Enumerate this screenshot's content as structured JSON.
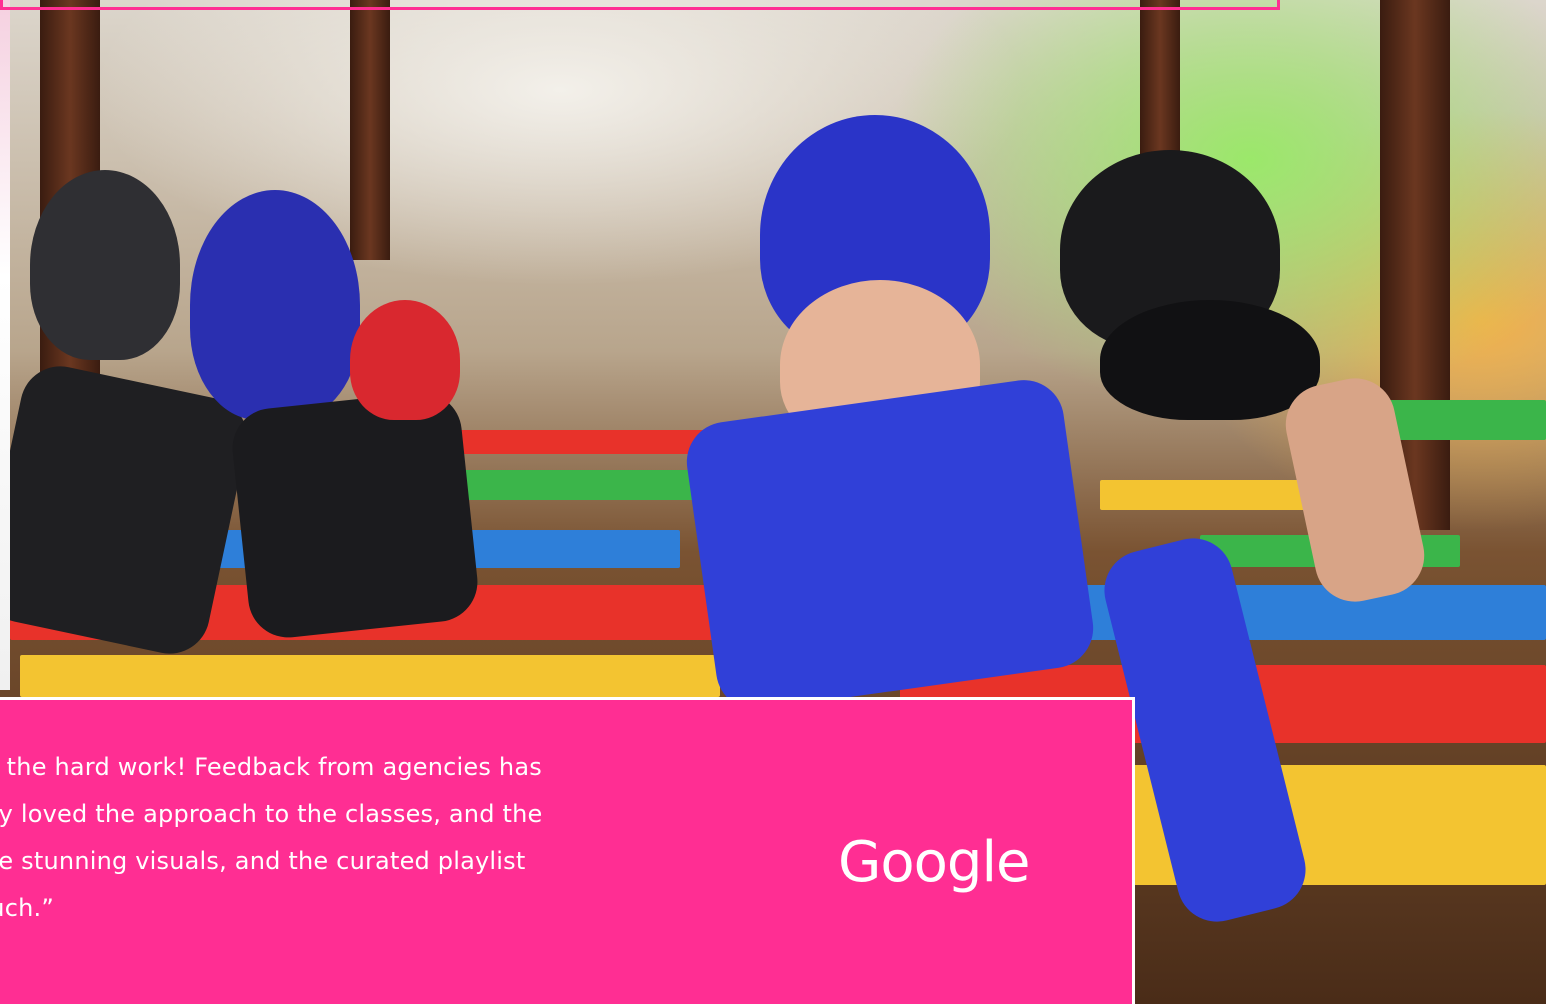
{
  "testimonial": {
    "lines": [
      "u for the hard work! Feedback from agencies has",
      " - they loved the approach to the classes, and the",
      " of the stunning visuals, and the curated playlist",
      "e touch.”"
    ],
    "brand": "Google"
  },
  "colors": {
    "accent": "#ff2e93",
    "text": "#ffffff"
  }
}
